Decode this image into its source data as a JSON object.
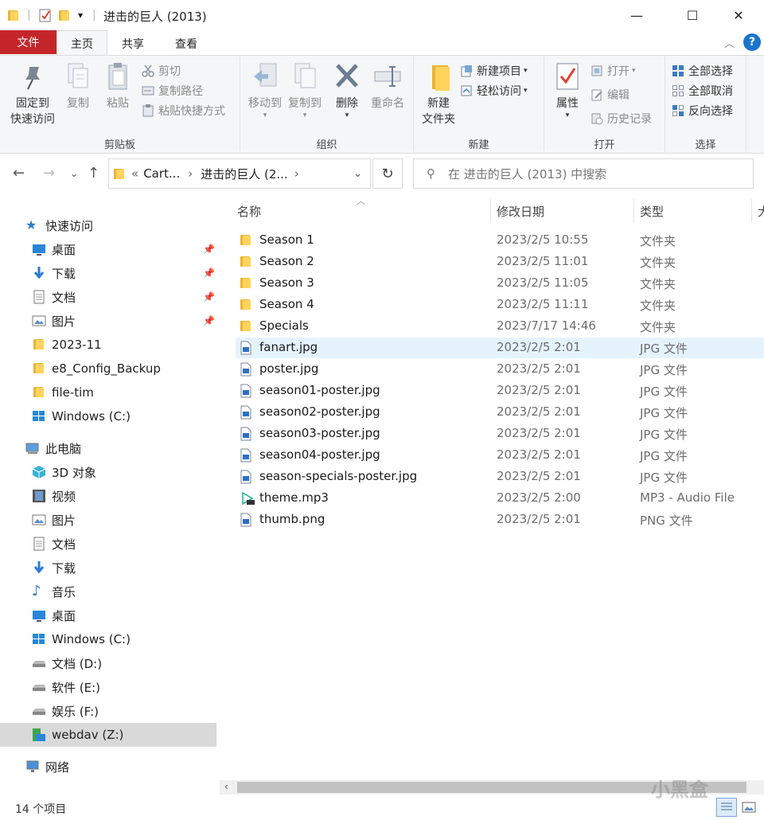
{
  "window": {
    "title": "进击的巨人 (2013)",
    "minimize": "—",
    "maximize": "☐",
    "close": "✕"
  },
  "quick_access_toolbar": {
    "dropdown": "▾"
  },
  "tabs": {
    "file": "文件",
    "home": "主页",
    "share": "共享",
    "view": "查看",
    "collapse": "︿",
    "help": "?"
  },
  "ribbon": {
    "clipboard": {
      "label": "剪贴板",
      "pin_line1": "固定到",
      "pin_line2": "快速访问",
      "copy": "复制",
      "paste": "粘贴",
      "cut": "剪切",
      "copy_path": "复制路径",
      "paste_shortcut": "粘贴快捷方式"
    },
    "organize": {
      "label": "组织",
      "move_to": "移动到",
      "copy_to": "复制到",
      "delete": "删除",
      "rename": "重命名"
    },
    "new": {
      "label": "新建",
      "new_folder_line1": "新建",
      "new_folder_line2": "文件夹",
      "new_item": "新建项目",
      "easy_access": "轻松访问"
    },
    "open": {
      "label": "打开",
      "properties": "属性",
      "open": "打开",
      "edit": "编辑",
      "history": "历史记录"
    },
    "select": {
      "label": "选择",
      "select_all": "全部选择",
      "select_none": "全部取消",
      "invert": "反向选择"
    }
  },
  "address": {
    "crumb_prefix": "«",
    "crumb1": "Cart...",
    "crumb_sep": "›",
    "crumb2": "进击的巨人 (2...",
    "search_placeholder": "在 进击的巨人 (2013) 中搜索"
  },
  "nav": {
    "quick_access": "快速访问",
    "qa_desktop": "桌面",
    "qa_downloads": "下载",
    "qa_documents": "文档",
    "qa_pictures": "图片",
    "qa_2023_11": "2023-11",
    "qa_e8": "e8_Config_Backup",
    "qa_filetim": "file-tim",
    "qa_windows": "Windows (C:)",
    "this_pc": "此电脑",
    "pc_3d": "3D 对象",
    "pc_videos": "视频",
    "pc_pictures": "图片",
    "pc_documents": "文档",
    "pc_downloads": "下载",
    "pc_music": "音乐",
    "pc_desktop": "桌面",
    "pc_windows": "Windows (C:)",
    "pc_d": "文档 (D:)",
    "pc_e": "软件 (E:)",
    "pc_f": "娱乐 (F:)",
    "pc_z": "webdav (Z:)",
    "network": "网络"
  },
  "columns": {
    "name": "名称",
    "modified": "修改日期",
    "type": "类型",
    "size": "大"
  },
  "files": [
    {
      "name": "Season 1",
      "date": "2023/2/5 10:55",
      "type": "文件夹"
    },
    {
      "name": "Season 2",
      "date": "2023/2/5 11:01",
      "type": "文件夹"
    },
    {
      "name": "Season 3",
      "date": "2023/2/5 11:05",
      "type": "文件夹"
    },
    {
      "name": "Season 4",
      "date": "2023/2/5 11:11",
      "type": "文件夹"
    },
    {
      "name": "Specials",
      "date": "2023/7/17 14:46",
      "type": "文件夹"
    },
    {
      "name": "fanart.jpg",
      "date": "2023/2/5 2:01",
      "type": "JPG 文件"
    },
    {
      "name": "poster.jpg",
      "date": "2023/2/5 2:01",
      "type": "JPG 文件"
    },
    {
      "name": "season01-poster.jpg",
      "date": "2023/2/5 2:01",
      "type": "JPG 文件"
    },
    {
      "name": "season02-poster.jpg",
      "date": "2023/2/5 2:01",
      "type": "JPG 文件"
    },
    {
      "name": "season03-poster.jpg",
      "date": "2023/2/5 2:01",
      "type": "JPG 文件"
    },
    {
      "name": "season04-poster.jpg",
      "date": "2023/2/5 2:01",
      "type": "JPG 文件"
    },
    {
      "name": "season-specials-poster.jpg",
      "date": "2023/2/5 2:01",
      "type": "JPG 文件"
    },
    {
      "name": "theme.mp3",
      "date": "2023/2/5 2:00",
      "type": "MP3 - Audio File"
    },
    {
      "name": "thumb.png",
      "date": "2023/2/5 2:01",
      "type": "PNG 文件"
    }
  ],
  "status": {
    "count": "14 个项目"
  },
  "watermark": "小黑盒",
  "colors": {
    "file_tab": "#c5262b",
    "folder": "#ffd35c",
    "accent": "#1a73d0",
    "hover_row": "#e5f3ff",
    "selected_nav": "#d9d9d9"
  }
}
